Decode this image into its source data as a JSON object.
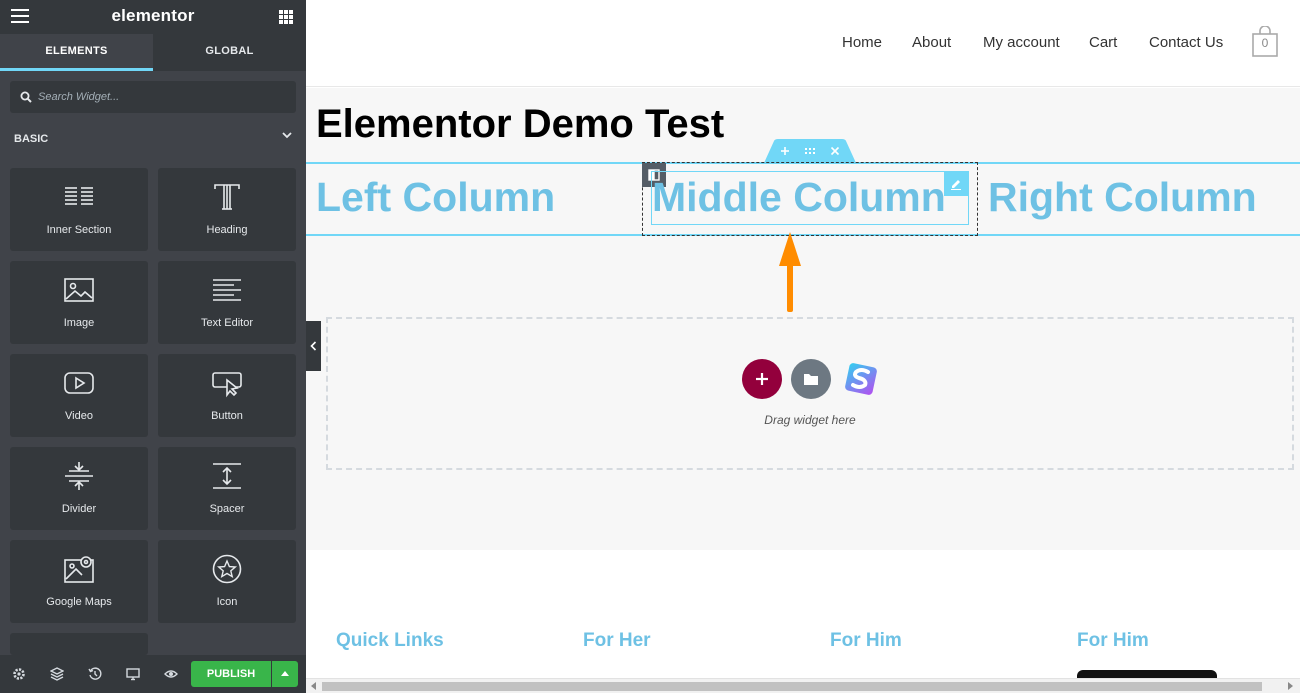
{
  "sidebar": {
    "brand": "elementor",
    "tabs": [
      {
        "label": "ELEMENTS",
        "active": true
      },
      {
        "label": "GLOBAL",
        "active": false
      }
    ],
    "search_placeholder": "Search Widget...",
    "category": "BASIC",
    "widgets": [
      {
        "label": "Inner Section",
        "icon": "inner-section-icon"
      },
      {
        "label": "Heading",
        "icon": "heading-icon"
      },
      {
        "label": "Image",
        "icon": "image-icon"
      },
      {
        "label": "Text Editor",
        "icon": "text-editor-icon"
      },
      {
        "label": "Video",
        "icon": "video-icon"
      },
      {
        "label": "Button",
        "icon": "button-icon"
      },
      {
        "label": "Divider",
        "icon": "divider-icon"
      },
      {
        "label": "Spacer",
        "icon": "spacer-icon"
      },
      {
        "label": "Google Maps",
        "icon": "google-maps-icon"
      },
      {
        "label": "Icon",
        "icon": "star-icon"
      }
    ],
    "bottom": {
      "publish_label": "PUBLISH",
      "icons": [
        "settings-icon",
        "navigator-icon",
        "history-icon",
        "responsive-icon",
        "preview-icon"
      ]
    }
  },
  "site": {
    "nav": [
      "Home",
      "About",
      "My account",
      "Cart",
      "Contact Us"
    ],
    "cart_count": "0"
  },
  "page": {
    "title": "Elementor Demo Test",
    "columns": [
      "Left Column",
      "Middle Column",
      "Right Column"
    ],
    "dropzone_text": "Drag widget here"
  },
  "footer": {
    "headings": [
      "Quick Links",
      "For Her",
      "For Him",
      "For Him"
    ]
  },
  "colors": {
    "accent": "#71d7f7",
    "heading_blue": "#6ec1e4",
    "publish_green": "#39b54a",
    "add_section": "#93003c",
    "arrow_orange": "#ff8c00",
    "sidebar_bg": "#404349"
  }
}
